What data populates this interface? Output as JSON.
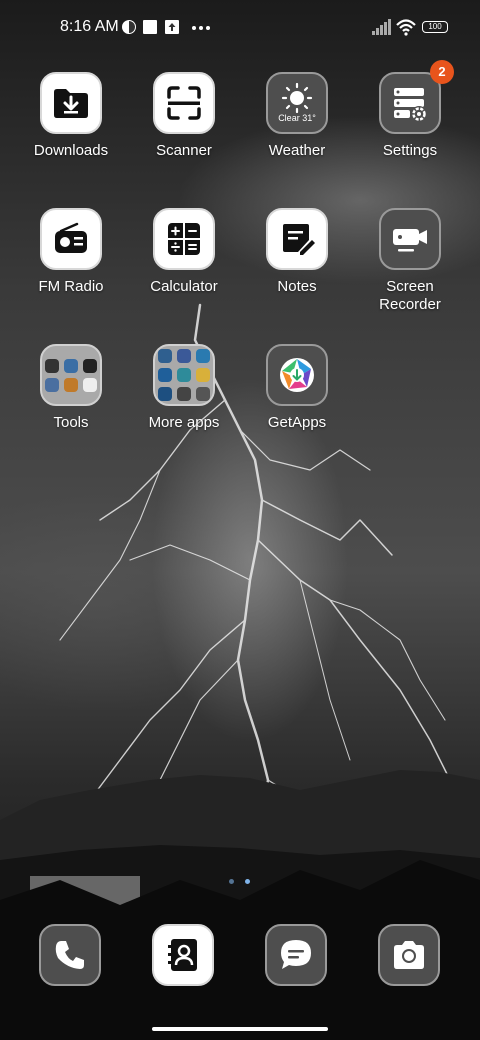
{
  "status_bar": {
    "time": "8:16 AM",
    "notification_icons": [
      "app-notification-icon",
      "square-notification-icon",
      "upload-notification-icon",
      "more-dots-icon"
    ],
    "system_icons": [
      "signal-icon",
      "wifi-icon",
      "battery-icon"
    ],
    "battery_level": "100"
  },
  "apps": {
    "row1": [
      {
        "label": "Downloads",
        "icon": "downloads-icon"
      },
      {
        "label": "Scanner",
        "icon": "scanner-icon"
      },
      {
        "label": "Weather",
        "icon": "weather-icon",
        "widget_text": "Clear 31°"
      },
      {
        "label": "Settings",
        "icon": "settings-icon",
        "badge": "2"
      }
    ],
    "row2": [
      {
        "label": "FM Radio",
        "icon": "radio-icon"
      },
      {
        "label": "Calculator",
        "icon": "calculator-icon"
      },
      {
        "label": "Notes",
        "icon": "notes-icon"
      },
      {
        "label": "Screen\nRecorder",
        "icon": "screen-recorder-icon"
      }
    ],
    "row3": [
      {
        "label": "Tools",
        "icon": "tools-folder-icon"
      },
      {
        "label": "More apps",
        "icon": "more-apps-folder-icon"
      },
      {
        "label": "GetApps",
        "icon": "getapps-icon"
      }
    ]
  },
  "page_indicator": {
    "pages": 2,
    "current": 1
  },
  "dock": [
    {
      "name": "phone",
      "icon": "phone-icon"
    },
    {
      "name": "contacts",
      "icon": "contacts-icon"
    },
    {
      "name": "messages",
      "icon": "messages-icon"
    },
    {
      "name": "camera",
      "icon": "camera-icon"
    }
  ],
  "colors": {
    "badge": "#e8541c",
    "page_dot_active": "#7fb3e8"
  }
}
